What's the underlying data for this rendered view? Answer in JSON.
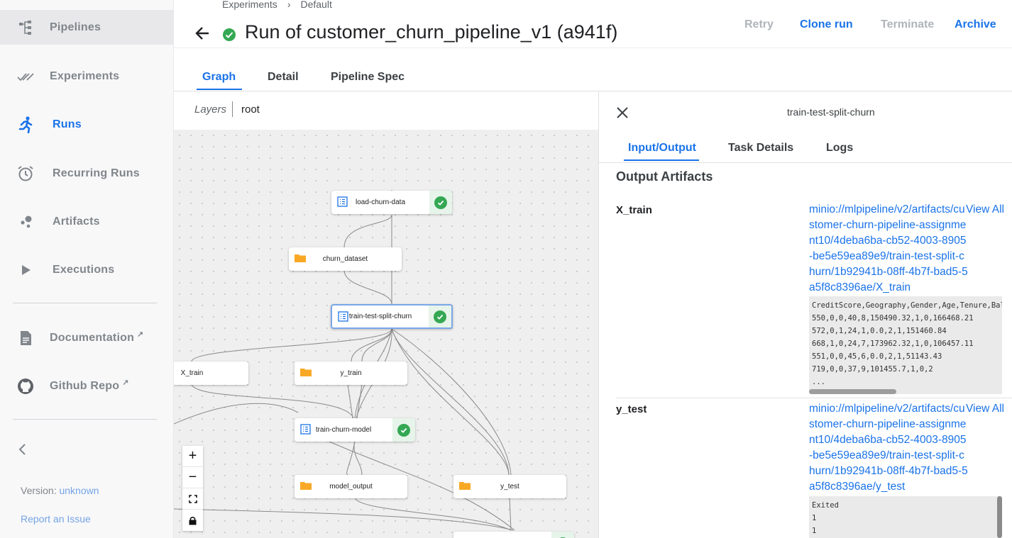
{
  "sidebar": {
    "items": [
      {
        "label": "Pipelines",
        "icon": "pipelines-icon"
      },
      {
        "label": "Experiments",
        "icon": "experiments-icon"
      },
      {
        "label": "Runs",
        "icon": "runs-icon"
      },
      {
        "label": "Recurring Runs",
        "icon": "alarm-clock-icon"
      },
      {
        "label": "Artifacts",
        "icon": "artifacts-icon"
      },
      {
        "label": "Executions",
        "icon": "play-icon"
      },
      {
        "label": "Documentation",
        "icon": "document-icon"
      },
      {
        "label": "Github Repo",
        "icon": "github-icon"
      }
    ],
    "version_label": "Version:",
    "version_value": "unknown",
    "report_label": "Report an Issue"
  },
  "header": {
    "breadcrumb": [
      "Experiments",
      "Default"
    ],
    "title": "Run of customer_churn_pipeline_v1 (a941f)",
    "actions": {
      "retry": "Retry",
      "clone": "Clone run",
      "terminate": "Terminate",
      "archive": "Archive"
    }
  },
  "tabs": [
    "Graph",
    "Detail",
    "Pipeline Spec"
  ],
  "layers": {
    "label": "Layers",
    "value": "root"
  },
  "graph": {
    "nodes": [
      {
        "label": "load-churn-data",
        "kind": "execution",
        "status": "succeeded"
      },
      {
        "label": "churn_dataset",
        "kind": "artifact"
      },
      {
        "label": "train-test-split-churn",
        "kind": "execution",
        "status": "succeeded",
        "selected": true
      },
      {
        "label": "X_train",
        "kind": "artifact"
      },
      {
        "label": "y_train",
        "kind": "artifact"
      },
      {
        "label": "train-churn-model",
        "kind": "execution",
        "status": "succeeded"
      },
      {
        "label": "model_output",
        "kind": "artifact"
      },
      {
        "label": "y_test",
        "kind": "artifact"
      }
    ],
    "zoom_controls": [
      "+",
      "−"
    ]
  },
  "panel": {
    "title": "train-test-split-churn",
    "tabs": [
      "Input/Output",
      "Task Details",
      "Logs"
    ],
    "section_title": "Output Artifacts",
    "artifacts": [
      {
        "name": "X_train",
        "uri": "minio://mlpipeline/v2/artifacts/customer-churn-pipeline-assignment10/4deba6ba-cb52-4003-8905-be5e59ea89e9/train-test-split-churn/1b92941b-08ff-4b7f-bad5-5a5f8c8396ae/X_train",
        "view_all": "View All",
        "preview": "CreditScore,Geography,Gender,Age,Tenure,Balance\n550,0,0,40,8,150490.32,1,0,166468.21\n572,0,1,24,1,0.0,2,1,151460.84\n668,1,0,24,7,173962.32,1,0,106457.11\n551,0,0,45,6,0.0,2,1,51143.43\n719,0,0,37,9,101455.7,1,0,2\n..."
      },
      {
        "name": "y_test",
        "uri": "minio://mlpipeline/v2/artifacts/customer-churn-pipeline-assignment10/4deba6ba-cb52-4003-8905-be5e59ea89e9/train-test-split-churn/1b92941b-08ff-4b7f-bad5-5a5f8c8396ae/y_test",
        "view_all": "View All",
        "preview": "Exited\n1\n1"
      }
    ]
  },
  "colors": {
    "accent": "#1a73e8",
    "success": "#34a853",
    "folder": "#f9a825",
    "muted": "#80868b"
  }
}
